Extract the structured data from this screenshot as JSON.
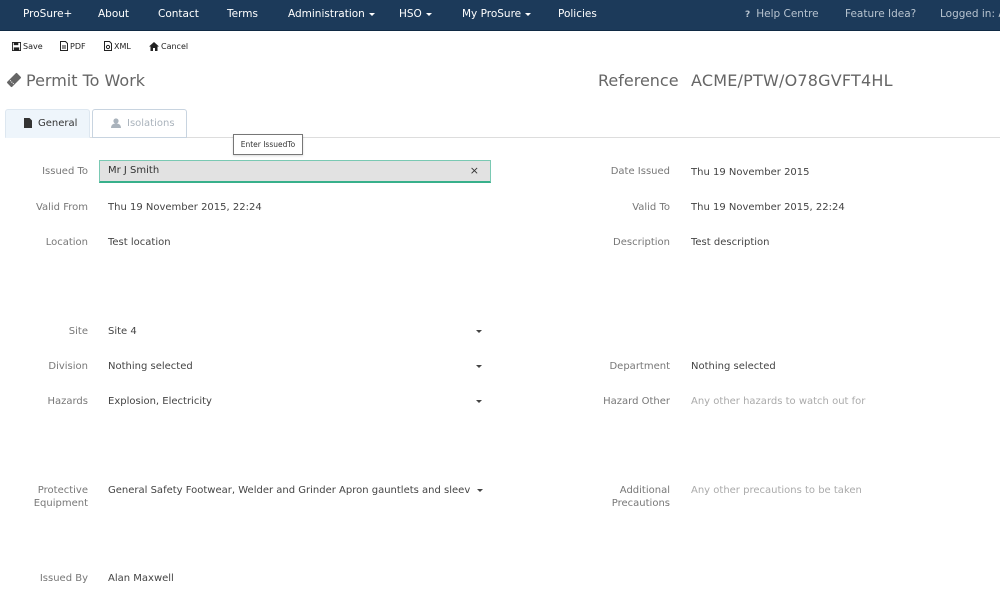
{
  "navbar": {
    "brand": "ProSure+",
    "items": [
      {
        "label": "About",
        "dropdown": false
      },
      {
        "label": "Contact",
        "dropdown": false
      },
      {
        "label": "Terms",
        "dropdown": false
      },
      {
        "label": "Administration",
        "dropdown": true
      },
      {
        "label": "HSO",
        "dropdown": true
      },
      {
        "label": "My ProSure",
        "dropdown": true
      },
      {
        "label": "Policies",
        "dropdown": false
      }
    ],
    "right": {
      "help_icon": "?",
      "help": "Help Centre",
      "feature": "Feature Idea?",
      "logged_in": "Logged in: Ay"
    }
  },
  "toolbar": {
    "save": "Save",
    "pdf": "PDF",
    "xml": "XML",
    "cancel": "Cancel"
  },
  "header": {
    "title": "Permit To Work",
    "reference_label": "Reference",
    "reference_value": "ACME/PTW/O78GVFT4HL"
  },
  "tabs": [
    {
      "label": "General",
      "active": true
    },
    {
      "label": "Isolations",
      "active": false
    }
  ],
  "tooltip": "Enter IssuedTo",
  "form": {
    "issued_to": {
      "label": "Issued To",
      "value": "Mr J Smith",
      "clear": "×"
    },
    "date_issued": {
      "label": "Date Issued",
      "value": "Thu 19 November 2015"
    },
    "valid_from": {
      "label": "Valid From",
      "value": "Thu 19 November 2015, 22:24"
    },
    "valid_to": {
      "label": "Valid To",
      "value": "Thu 19 November 2015, 22:24"
    },
    "location": {
      "label": "Location",
      "value": "Test location"
    },
    "description": {
      "label": "Description",
      "value": "Test description"
    },
    "site": {
      "label": "Site",
      "value": "Site 4"
    },
    "division": {
      "label": "Division",
      "value": "Nothing selected"
    },
    "department": {
      "label": "Department",
      "value": "Nothing selected"
    },
    "hazards": {
      "label": "Hazards",
      "value": "Explosion, Electricity"
    },
    "hazard_other": {
      "label": "Hazard Other",
      "placeholder": "Any other hazards to watch out for"
    },
    "protective_equipment": {
      "label_line1": "Protective",
      "label_line2": "Equipment",
      "value": "General Safety Footwear, Welder and Grinder Apron gauntlets and sleeves, Cas"
    },
    "additional_precautions": {
      "label_line1": "Additional",
      "label_line2": "Precautions",
      "placeholder": "Any other precautions to be taken"
    },
    "issued_by": {
      "label": "Issued By",
      "value": "Alan Maxwell"
    }
  },
  "colors": {
    "navbar_bg": "#1c3a5a",
    "input_focus_border": "#38b08b",
    "active_tab_bg": "#eef5fb"
  }
}
